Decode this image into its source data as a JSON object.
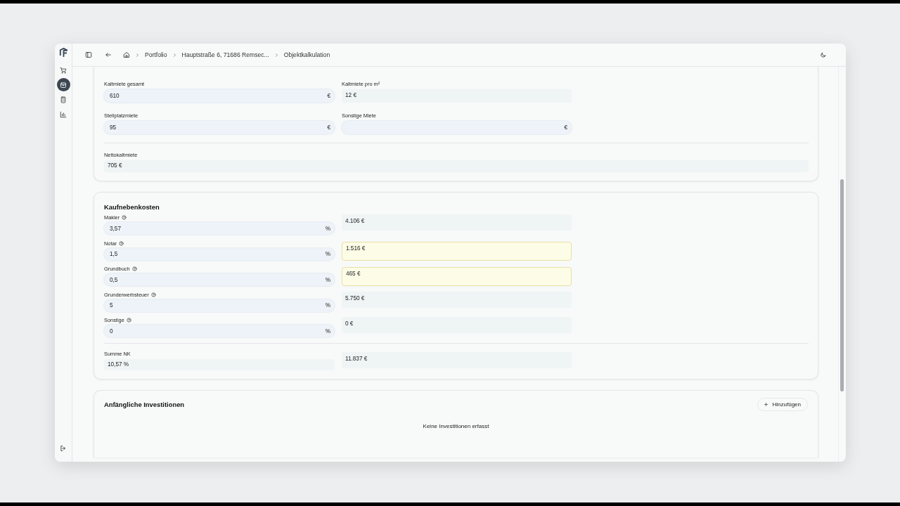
{
  "sidebar": {
    "items": [
      {
        "kind": "cart",
        "selected": false
      },
      {
        "kind": "box",
        "selected": true
      },
      {
        "kind": "calculator",
        "selected": false
      },
      {
        "kind": "chart",
        "selected": false
      }
    ]
  },
  "breadcrumbs": [
    "Portfolio",
    "Hauptstraße 6, 71686 Remsec...",
    "Objektkalkulation"
  ],
  "rent": {
    "fields": [
      {
        "label": "Kaltmiete gesamt",
        "kind": "input",
        "value": "610",
        "unit": "€"
      },
      {
        "label": "Kaltmiete pro m²",
        "kind": "readout",
        "value": "12 €"
      },
      {
        "label": "Stellplatzmiete",
        "kind": "input",
        "value": "95",
        "unit": "€"
      },
      {
        "label": "Sonstige Miete",
        "kind": "input",
        "unit": "€"
      }
    ],
    "total": {
      "label": "Nettokaltmiete",
      "value": "705 €"
    }
  },
  "purchase_costs": {
    "title": "Kaufnebenkosten",
    "rows": [
      {
        "label": "Makler",
        "value": "3,57",
        "unit": "%",
        "amount": "4.106 €",
        "highlighted": false
      },
      {
        "label": "Notar",
        "value": "1,5",
        "unit": "%",
        "amount": "1.516 €",
        "highlighted": true
      },
      {
        "label": "Grundbuch",
        "value": "0,5",
        "unit": "%",
        "amount": "465 €",
        "highlighted": true
      },
      {
        "label": "Grunderwerbsteuer",
        "value": "5",
        "unit": "%",
        "amount": "5.750 €",
        "highlighted": false
      },
      {
        "label": "Sonstige",
        "value": "0",
        "unit": "%",
        "amount": "0 €",
        "highlighted": false
      }
    ],
    "total": {
      "label": "Summe NK",
      "percent": "10,57 %",
      "amount": "11.837 €"
    }
  },
  "investments": {
    "title": "Anfängliche Investitionen",
    "add_button": "Hinzufügen",
    "empty_text": "Keine Investitionen erfasst"
  }
}
